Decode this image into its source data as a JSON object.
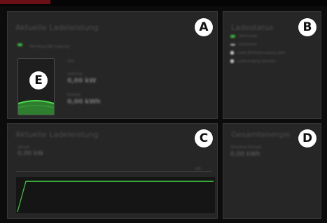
{
  "panels": {
    "a": {
      "title": "Aktuelle Ladeleistung",
      "badge": "A",
      "status_text": "Fahrzeug lädt (Ladung)",
      "battery_badge": "E",
      "stats": [
        {
          "label": "Zeit",
          "value": ""
        },
        {
          "label": "Leistung",
          "value": "0,00 kW"
        },
        {
          "label": "Energie",
          "value": "0,00 kWh"
        }
      ]
    },
    "b": {
      "title": "Ladestatus",
      "badge": "B",
      "rows": [
        {
          "text": "Verbunden",
          "color": "#3fbf3f"
        },
        {
          "text": "Autorisiert",
          "color": "#cfcfcf"
        },
        {
          "text": "Lade-/Entladevorgang aktiv",
          "color": "#cfcfcf"
        },
        {
          "text": "Ladevorgang beendet",
          "color": "#cfcfcf"
        }
      ]
    },
    "c": {
      "title": "Aktuelle Ladeleistung",
      "badge": "C",
      "current_label": "aktuell",
      "current_value": "0,00 kW",
      "scale_label": "kW"
    },
    "d": {
      "title": "Gesamtenergie",
      "badge": "D",
      "label": "Geladene Energie",
      "value": "0,00 kWh"
    }
  },
  "chart_data": {
    "type": "line",
    "title": "",
    "xlabel": "",
    "ylabel": "",
    "ylim": [
      0,
      1
    ],
    "grid": false,
    "series": [
      {
        "values": [
          0.0,
          0.95,
          0.95,
          0.95,
          0.95,
          0.95,
          0.95,
          0.95,
          0.95,
          0.95,
          0.95,
          0.95,
          0.95
        ]
      }
    ]
  },
  "colors": {
    "accent_green": "#3fbf3f",
    "brand": "#6a0f15"
  }
}
